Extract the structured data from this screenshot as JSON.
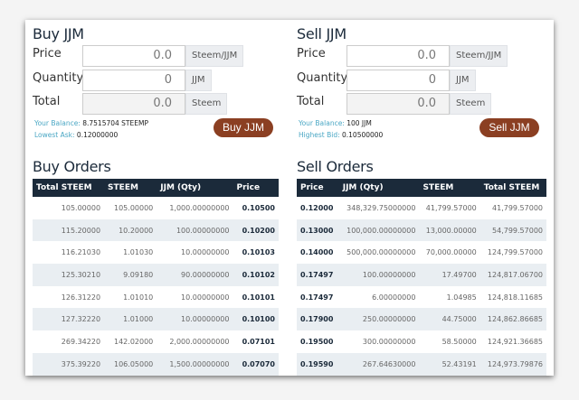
{
  "buy": {
    "title": "Buy JJM",
    "price_label": "Price",
    "price_value": "0.0",
    "price_unit": "Steem/JJM",
    "qty_label": "Quantity",
    "qty_value": "0",
    "qty_unit": "JJM",
    "total_label": "Total",
    "total_value": "0.0",
    "total_unit": "Steem",
    "balance_label": "Your Balance:",
    "balance_value": "8.7515704 STEEMP",
    "ask_label": "Lowest Ask:",
    "ask_value": "0.12000000",
    "button": "Buy JJM"
  },
  "sell": {
    "title": "Sell JJM",
    "price_label": "Price",
    "price_value": "0.0",
    "price_unit": "Steem/JJM",
    "qty_label": "Quantity",
    "qty_value": "0",
    "qty_unit": "JJM",
    "total_label": "Total",
    "total_value": "0.0",
    "total_unit": "Steem",
    "balance_label": "Your Balance:",
    "balance_value": "100 JJM",
    "bid_label": "Highest Bid:",
    "bid_value": "0.10500000",
    "button": "Sell JJM"
  },
  "buy_orders": {
    "title": "Buy Orders",
    "headers": [
      "Total STEEM",
      "STEEM",
      "JJM (Qty)",
      "Price"
    ],
    "rows": [
      [
        "105.00000",
        "105.00000",
        "1,000.00000000",
        "0.10500"
      ],
      [
        "115.20000",
        "10.20000",
        "100.00000000",
        "0.10200"
      ],
      [
        "116.21030",
        "1.01030",
        "10.00000000",
        "0.10103"
      ],
      [
        "125.30210",
        "9.09180",
        "90.00000000",
        "0.10102"
      ],
      [
        "126.31220",
        "1.01010",
        "10.00000000",
        "0.10101"
      ],
      [
        "127.32220",
        "1.01000",
        "10.00000000",
        "0.10100"
      ],
      [
        "269.34220",
        "142.02000",
        "2,000.00000000",
        "0.07101"
      ],
      [
        "375.39220",
        "106.05000",
        "1,500.00000000",
        "0.07070"
      ]
    ]
  },
  "sell_orders": {
    "title": "Sell Orders",
    "headers": [
      "Price",
      "JJM (Qty)",
      "STEEM",
      "Total STEEM"
    ],
    "rows": [
      [
        "0.12000",
        "348,329.75000000",
        "41,799.57000",
        "41,799.57000"
      ],
      [
        "0.13000",
        "100,000.00000000",
        "13,000.00000",
        "54,799.57000"
      ],
      [
        "0.14000",
        "500,000.00000000",
        "70,000.00000",
        "124,799.57000"
      ],
      [
        "0.17497",
        "100.00000000",
        "17.49700",
        "124,817.06700"
      ],
      [
        "0.17497",
        "6.00000000",
        "1.04985",
        "124,818.11685"
      ],
      [
        "0.17900",
        "250.00000000",
        "44.75000",
        "124,862.86685"
      ],
      [
        "0.19500",
        "300.00000000",
        "58.50000",
        "124,921.36685"
      ],
      [
        "0.19590",
        "267.64630000",
        "52.43191",
        "124,973.79876"
      ]
    ]
  }
}
